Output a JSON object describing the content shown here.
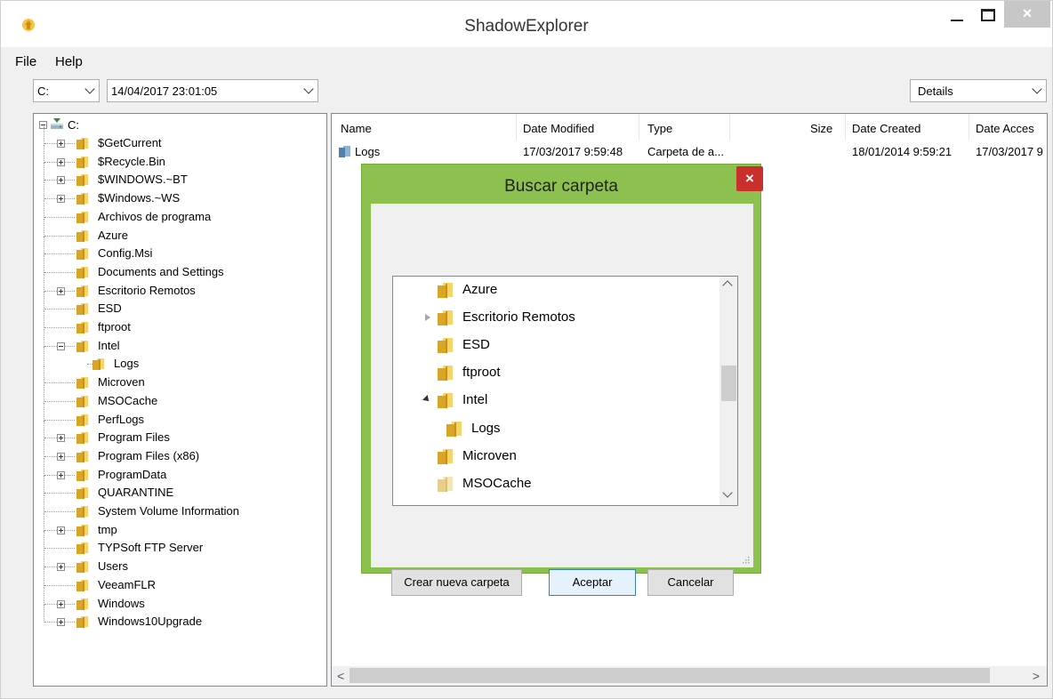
{
  "window": {
    "title": "ShadowExplorer",
    "close_glyph": "×"
  },
  "menu": {
    "items": [
      "File",
      "Help"
    ]
  },
  "toolbar": {
    "drive": "C:",
    "snapshot": "14/04/2017 23:01:05",
    "view": "Details"
  },
  "tree": {
    "root": "C:",
    "items": [
      {
        "label": "$GetCurrent",
        "expandable": true
      },
      {
        "label": "$Recycle.Bin",
        "expandable": true
      },
      {
        "label": "$WINDOWS.~BT",
        "expandable": true
      },
      {
        "label": "$Windows.~WS",
        "expandable": true
      },
      {
        "label": "Archivos de programa",
        "expandable": false
      },
      {
        "label": "Azure",
        "expandable": false
      },
      {
        "label": "Config.Msi",
        "expandable": false
      },
      {
        "label": "Documents and Settings",
        "expandable": false
      },
      {
        "label": "Escritorio Remotos",
        "expandable": true
      },
      {
        "label": "ESD",
        "expandable": false
      },
      {
        "label": "ftproot",
        "expandable": false
      },
      {
        "label": "Intel",
        "expandable": true,
        "expanded": true
      },
      {
        "label": "Logs",
        "expandable": false,
        "child": true
      },
      {
        "label": "Microven",
        "expandable": false
      },
      {
        "label": "MSOCache",
        "expandable": false
      },
      {
        "label": "PerfLogs",
        "expandable": false
      },
      {
        "label": "Program Files",
        "expandable": true
      },
      {
        "label": "Program Files (x86)",
        "expandable": true
      },
      {
        "label": "ProgramData",
        "expandable": true
      },
      {
        "label": "QUARANTINE",
        "expandable": false
      },
      {
        "label": "System Volume Information",
        "expandable": false
      },
      {
        "label": "tmp",
        "expandable": true
      },
      {
        "label": "TYPSoft FTP Server",
        "expandable": false
      },
      {
        "label": "Users",
        "expandable": true
      },
      {
        "label": "VeeamFLR",
        "expandable": false
      },
      {
        "label": "Windows",
        "expandable": true
      },
      {
        "label": "Windows10Upgrade",
        "expandable": true
      }
    ]
  },
  "list": {
    "columns": [
      "Name",
      "Date Modified",
      "Type",
      "Size",
      "Date Created",
      "Date Acces"
    ],
    "rows": [
      {
        "name": "Logs",
        "modified": "17/03/2017 9:59:48",
        "type": "Carpeta de a...",
        "size": "",
        "created": "18/01/2014 9:59:21",
        "accessed": "17/03/2017 9"
      }
    ],
    "scroll_left": "<",
    "scroll_right": ">"
  },
  "dialog": {
    "title": "Buscar carpeta",
    "close_glyph": "×",
    "items": [
      {
        "label": "Azure",
        "level": 0,
        "arrow": "none"
      },
      {
        "label": "Escritorio Remotos",
        "level": 0,
        "arrow": "collapsed"
      },
      {
        "label": "ESD",
        "level": 0,
        "arrow": "none"
      },
      {
        "label": "ftproot",
        "level": 0,
        "arrow": "none"
      },
      {
        "label": "Intel",
        "level": 0,
        "arrow": "expanded"
      },
      {
        "label": "Logs",
        "level": 1,
        "arrow": "none"
      },
      {
        "label": "Microven",
        "level": 0,
        "arrow": "none"
      },
      {
        "label": "MSOCache",
        "level": 0,
        "arrow": "none",
        "pale": true
      }
    ],
    "buttons": {
      "new_folder": "Crear nueva carpeta",
      "ok": "Aceptar",
      "cancel": "Cancelar"
    }
  }
}
